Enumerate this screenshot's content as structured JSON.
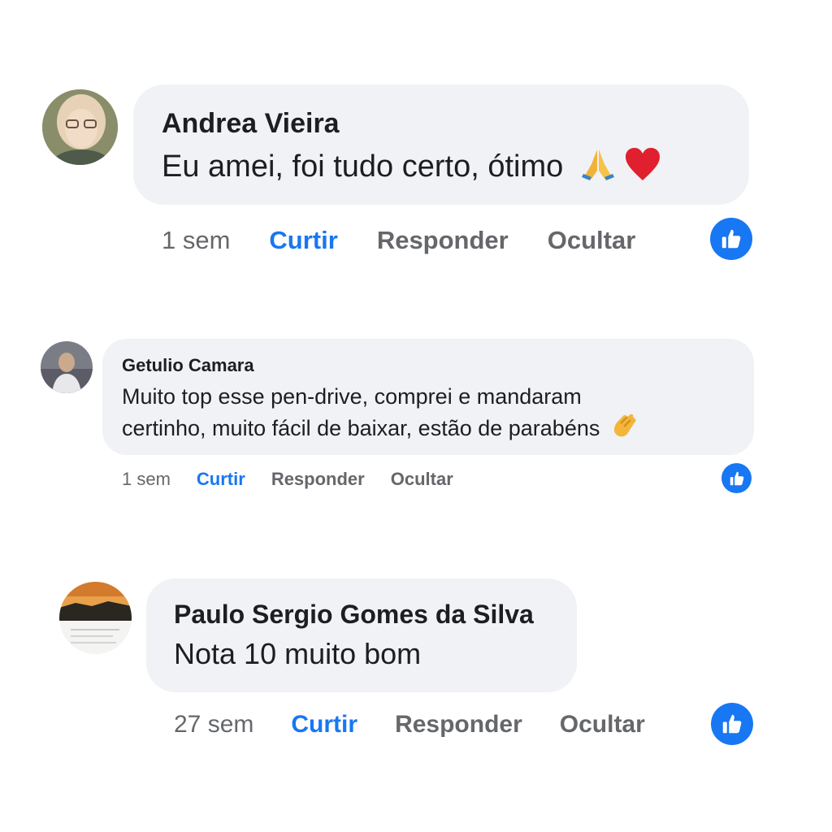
{
  "comments": [
    {
      "author": "Andrea Vieira",
      "text": "Eu amei, foi tudo certo, ótimo",
      "emojis": [
        "folded-hands-emoji",
        "red-heart-emoji"
      ],
      "time": "1 sem",
      "like_label": "Curtir",
      "reply_label": "Responder",
      "hide_label": "Ocultar",
      "reaction": "like"
    },
    {
      "author": "Getulio Camara",
      "text_line1": "Muito top esse pen-drive, comprei e mandaram",
      "text_line2": "certinho, muito fácil de baixar, estão de parabéns",
      "emojis": [
        "clapping-hands-emoji"
      ],
      "time": "1 sem",
      "like_label": "Curtir",
      "reply_label": "Responder",
      "hide_label": "Ocultar",
      "reaction": "like"
    },
    {
      "author": "Paulo Sergio Gomes da Silva",
      "text": "Nota 10 muito bom",
      "time": "27 sem",
      "like_label": "Curtir",
      "reply_label": "Responder",
      "hide_label": "Ocultar",
      "reaction": "like"
    }
  ],
  "colors": {
    "bubble_bg": "#f0f2f5",
    "like_blue": "#1877f2",
    "meta_gray": "#65676b"
  }
}
